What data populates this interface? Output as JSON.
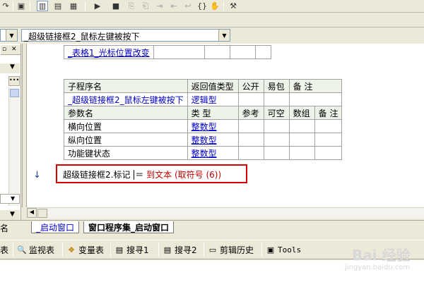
{
  "selector": {
    "left_value": "",
    "event_value": "_超级链接框2_鼠标左键被按下"
  },
  "prev_table": {
    "name": "_表格1_光标位置改变"
  },
  "sub_table": {
    "headers": [
      "子程序名",
      "返回值类型",
      "公开",
      "易包",
      "备 注"
    ],
    "row": {
      "name": "_超级链接框2_鼠标左键被按下",
      "return_type": "逻辑型"
    },
    "param_headers": [
      "参数名",
      "类 型",
      "参考",
      "可空",
      "数组",
      "备 注"
    ],
    "params": [
      {
        "name": "横向位置",
        "type": "整数型"
      },
      {
        "name": "纵向位置",
        "type": "整数型"
      },
      {
        "name": "功能键状态",
        "type": "整数型"
      }
    ]
  },
  "code": {
    "target": "超级链接框2.标记",
    "op": "＝",
    "func": "到文本",
    "arg": "(取符号 (6))"
  },
  "tabs": [
    {
      "label": "_启动窗口"
    },
    {
      "label": "窗口程序集_启动窗口"
    }
  ],
  "bottom": {
    "tab0": "表",
    "monitor": "监视表",
    "vars": "变量表",
    "search1": "搜寻1",
    "search2": "搜寻2",
    "clip": "剪辑历史",
    "tools": "Tools"
  },
  "watermark": {
    "brand": "Bai 经验",
    "url": "jingyan.baidu.com"
  },
  "colors": {
    "highlight_box": "#d60000",
    "keyword_blue": "#0000c8",
    "code_red": "#c00000"
  }
}
